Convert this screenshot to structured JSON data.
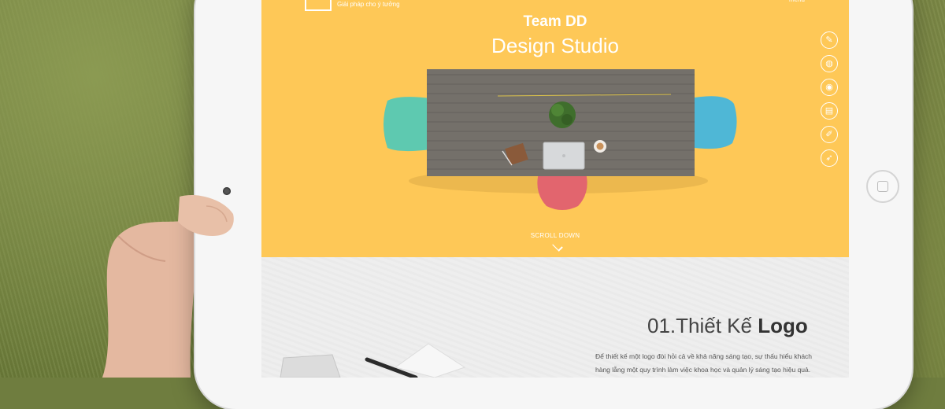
{
  "site": {
    "tagline": "Giải pháp cho ý tưởng",
    "menu_label": "menu",
    "hero_title": "Team DD",
    "hero_subtitle": "Design Studio",
    "scroll_label": "SCROLL DOWN"
  },
  "side_icons": [
    "pencil-icon",
    "globe-icon",
    "camera-icon",
    "document-icon",
    "edit-icon",
    "rocket-icon"
  ],
  "section": {
    "title_prefix": "01.Thiết Kế ",
    "title_bold": "Logo",
    "body_line1": "Để thiết kế một logo đòi hỏi cả về khả năng sáng tạo, sự thấu hiểu khách",
    "body_line2": "hàng lẫng một quy trình làm việc khoa học và quản lý sáng tạo hiệu quả."
  },
  "colors": {
    "hero_background": "#fec857",
    "section_background": "#eeeeee",
    "chair_left": "#5ec9b0",
    "chair_right": "#4fb7d6",
    "chair_bottom": "#e2656e",
    "table": "#6e6a64"
  }
}
